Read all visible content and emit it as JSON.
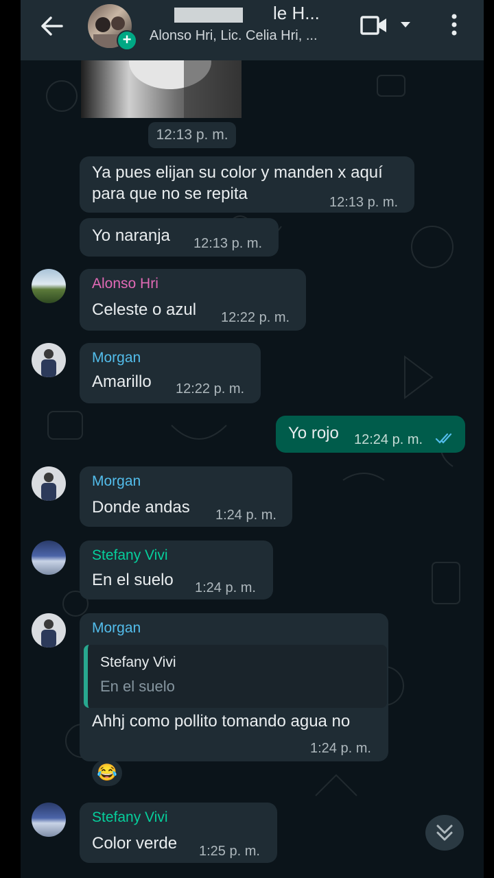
{
  "header": {
    "title_visible": "le H...",
    "members": "Alonso Hri, Lic. Celia Hri, ..."
  },
  "icons": {
    "back": "arrow-left-icon",
    "add": "plus-icon",
    "video": "video-camera-icon",
    "dropdown": "caret-down-icon",
    "menu": "more-vertical-icon",
    "scroll": "double-chevron-down-icon"
  },
  "colors": {
    "header_bg": "#1f2c34",
    "chat_bg": "#0b141a",
    "incoming_bubble": "#1f2c34",
    "outgoing_bubble": "#005c4b",
    "read_ticks": "#53bdeb",
    "alonso_name": "#e26ab6",
    "morgan_name": "#53bdeb",
    "stefany_name": "#06cf9c"
  },
  "messages": {
    "image_time": "12:13 p. m.",
    "m1_text_line1": "Ya pues elijan su color y manden x aquí",
    "m1_text_line2": "para que no se repita",
    "m1_time": "12:13 p. m.",
    "m2_text": "Yo naranja",
    "m2_time": "12:13 p. m.",
    "m3_name": "Alonso Hri",
    "m3_text": "Celeste o azul",
    "m3_time": "12:22 p. m.",
    "m4_name": "Morgan",
    "m4_text": "Amarillo",
    "m4_time": "12:22 p. m.",
    "m5_text": "Yo rojo",
    "m5_time": "12:24 p. m.",
    "m6_name": "Morgan",
    "m6_text": "Donde andas",
    "m6_time": "1:24 p. m.",
    "m7_name": "Stefany Vivi",
    "m7_text": "En el suelo",
    "m7_time": "1:24 p. m.",
    "m8_name": "Morgan",
    "m8_quote_name": "Stefany Vivi",
    "m8_quote_text": "En el suelo",
    "m8_text": "Ahhj como pollito tomando agua no",
    "m8_time": "1:24 p. m.",
    "m8_reaction": "😂",
    "m9_name": "Stefany Vivi",
    "m9_text": "Color verde",
    "m9_time": "1:25 p. m."
  }
}
